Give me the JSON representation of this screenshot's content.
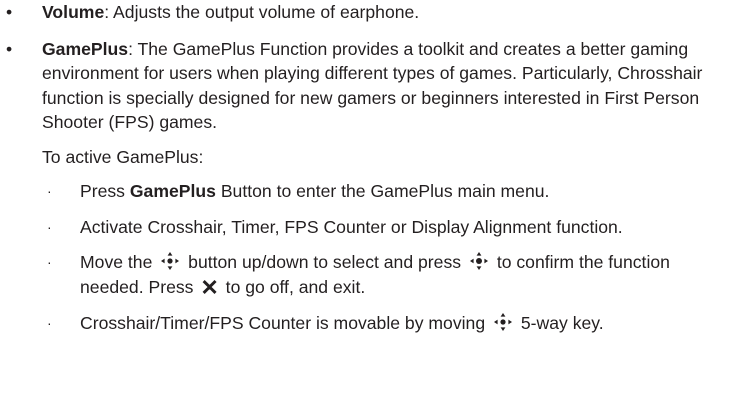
{
  "items": [
    {
      "bullet": "•",
      "term": "Volume",
      "text": ": Adjusts the output volume of earphone."
    },
    {
      "bullet": "•",
      "term": "GamePlus",
      "text": ": The GamePlus Function provides a toolkit and creates a better gaming environment for users when playing different types of games. Particularly, Chrosshair function is specially designed for new gamers or beginners interested in First Person Shooter (FPS) games.",
      "follow": "To active GamePlus:"
    }
  ],
  "steps": {
    "bullet": "·",
    "s1_pre": "Press ",
    "s1_bold": "GamePlus",
    "s1_post": " Button to enter the GamePlus main menu.",
    "s2": "Activate Crosshair, Timer, FPS Counter or Display Alignment function.",
    "s3_a": "Move the ",
    "s3_b": " button up/down to select and press ",
    "s3_c": " to confirm the function needed. Press ",
    "s3_x": "✕",
    "s3_d": " to go off, and exit.",
    "s4_a": "Crosshair/Timer/FPS Counter is movable by moving ",
    "s4_b": " 5-way key."
  },
  "icons": {
    "five_way": "five-way-key-icon",
    "close": "x-icon"
  }
}
